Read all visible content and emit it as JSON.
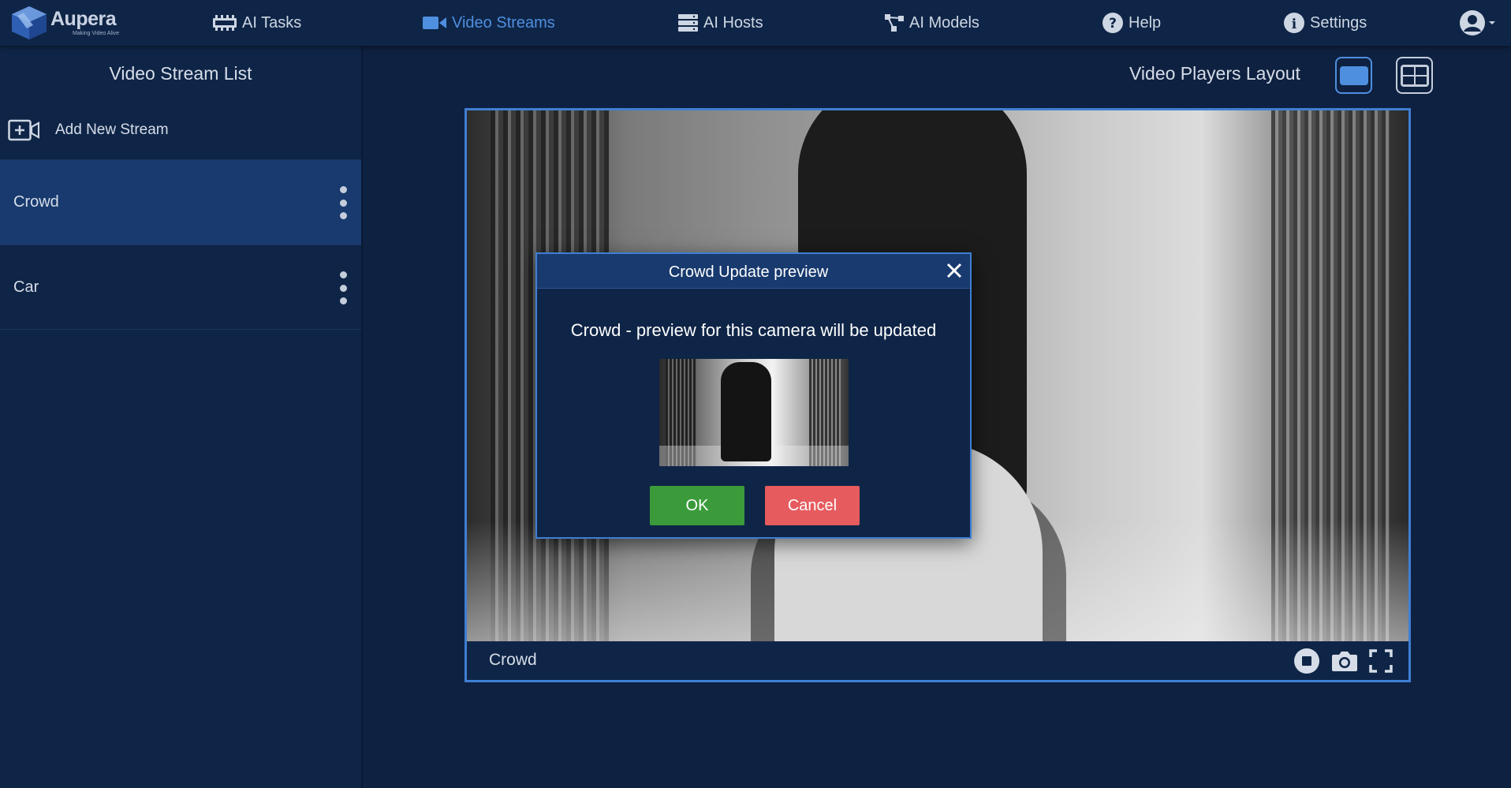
{
  "brand": {
    "name": "Aupera",
    "tagline": "Making Video Alive"
  },
  "nav": {
    "items": [
      {
        "label": "AI Tasks",
        "icon": "ai-tasks-icon"
      },
      {
        "label": "Video Streams",
        "icon": "video-camera-icon",
        "active": true
      },
      {
        "label": "AI Hosts",
        "icon": "server-icon"
      },
      {
        "label": "AI Models",
        "icon": "network-icon"
      },
      {
        "label": "Help",
        "icon": "question-circle-icon"
      },
      {
        "label": "Settings",
        "icon": "info-circle-icon"
      }
    ],
    "user_icon": "user-circle-icon"
  },
  "sidebar": {
    "title": "Video Stream List",
    "add_label": "Add New Stream",
    "streams": [
      {
        "name": "Crowd",
        "selected": true
      },
      {
        "name": "Car",
        "selected": false
      }
    ]
  },
  "main": {
    "layout_label": "Video Players Layout",
    "player": {
      "stream_name": "Crowd",
      "controls": [
        "stop-icon",
        "camera-icon",
        "fullscreen-icon"
      ]
    }
  },
  "modal": {
    "title": "Crowd Update preview",
    "message": "Crowd - preview for this camera will be updated",
    "ok_label": "OK",
    "cancel_label": "Cancel"
  },
  "colors": {
    "background": "#0e2141",
    "panel": "#0f2547",
    "accent": "#4f8fe0",
    "selected": "#183a6e",
    "ok": "#3b9b3b",
    "cancel": "#e55b5e"
  }
}
